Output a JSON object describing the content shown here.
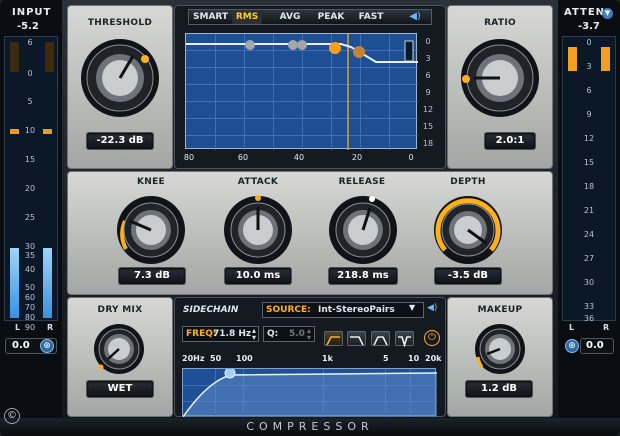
{
  "meters": {
    "input": {
      "title": "INPUT",
      "value": "-5.2",
      "scale": [
        "6",
        "0",
        "5",
        "10",
        "15",
        "20",
        "25",
        "30",
        "35",
        "40",
        "50",
        "60",
        "70",
        "80",
        "90"
      ],
      "left_label": "L",
      "right_label": "R",
      "foot_value": "0.0",
      "left_level": 0.75,
      "right_level": 0.75
    },
    "atten": {
      "title": "ATTEN",
      "value": "-3.7",
      "scale": [
        "0",
        "3",
        "6",
        "9",
        "12",
        "15",
        "18",
        "21",
        "24",
        "27",
        "30",
        "33",
        "36"
      ],
      "left_label": "L",
      "right_label": "R",
      "foot_value": "0.0",
      "left_level": 0.08,
      "right_level": 0.08
    }
  },
  "threshold": {
    "label": "THRESHOLD",
    "value": "-22.3 dB",
    "position": 0.65
  },
  "ratio": {
    "label": "RATIO",
    "value": "2.0:1",
    "position": 0.05
  },
  "graph": {
    "modes": [
      "SMART",
      "RMS",
      "AVG",
      "PEAK",
      "FAST"
    ],
    "active_mode": "RMS",
    "x_ticks": [
      "80",
      "60",
      "40",
      "20",
      "0"
    ],
    "y_ticks": [
      "0",
      "3",
      "6",
      "9",
      "12",
      "15",
      "18"
    ]
  },
  "knee": {
    "label": "KNEE",
    "value": "7.3 dB",
    "position": 0.3
  },
  "attack": {
    "label": "ATTACK",
    "value": "10.0 ms",
    "position": 0.5
  },
  "release": {
    "label": "RELEASE",
    "value": "218.8 ms",
    "position": 0.55
  },
  "depth": {
    "label": "DEPTH",
    "value": "-3.5 dB",
    "position": 0.92
  },
  "dry_mix": {
    "label": "DRY MIX",
    "value": "WET",
    "position": 0.0
  },
  "makeup": {
    "label": "MAKEUP",
    "value": "1.2 dB",
    "position": 0.15
  },
  "sidechain": {
    "title": "SIDECHAIN",
    "source_label": "SOURCE:",
    "source_value": "Int-StereoPairs",
    "freq_label": "FREQ:",
    "freq_value": "71.8 Hz",
    "q_label": "Q:",
    "q_value": "5.0",
    "freq_ticks": [
      "20Hz",
      "50",
      "100",
      "1k",
      "5",
      "10",
      "20k"
    ]
  },
  "footer": {
    "title": "COMPRESSOR"
  },
  "colors": {
    "accent": "#ffb21a",
    "meter_blue": "#4fb0ff",
    "graph_bg": "#1f4f96",
    "panel": "#c9cac8"
  }
}
